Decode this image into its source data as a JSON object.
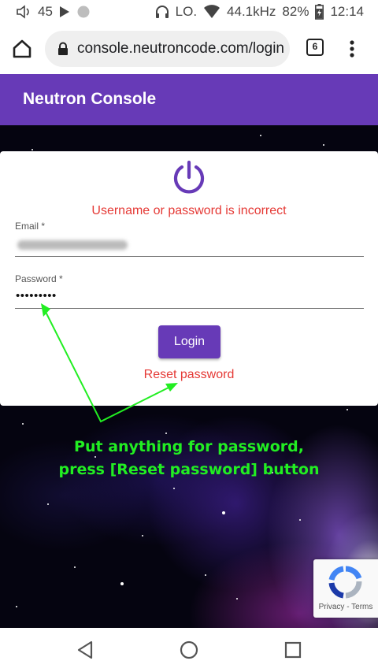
{
  "status_bar": {
    "volume_value": "45",
    "lo_label": "LO.",
    "audio_rate": "44.1kHz",
    "battery": "82%",
    "time": "12:14"
  },
  "browser": {
    "url": "console.neutroncode.com/login",
    "tab_count": "6"
  },
  "app": {
    "title": "Neutron Console"
  },
  "login": {
    "error": "Username or password is incorrect",
    "email_label": "Email *",
    "password_label": "Password *",
    "password_mask": "•••••••••",
    "login_button": "Login",
    "reset_link": "Reset password"
  },
  "annotation": {
    "line1": "Put anything for password,",
    "line2": "press [Reset password] button",
    "color": "#22ee22"
  },
  "recaptcha": {
    "privacy": "Privacy",
    "separator": " - ",
    "terms": "Terms"
  },
  "colors": {
    "primary": "#673ab7",
    "error": "#e53935"
  }
}
